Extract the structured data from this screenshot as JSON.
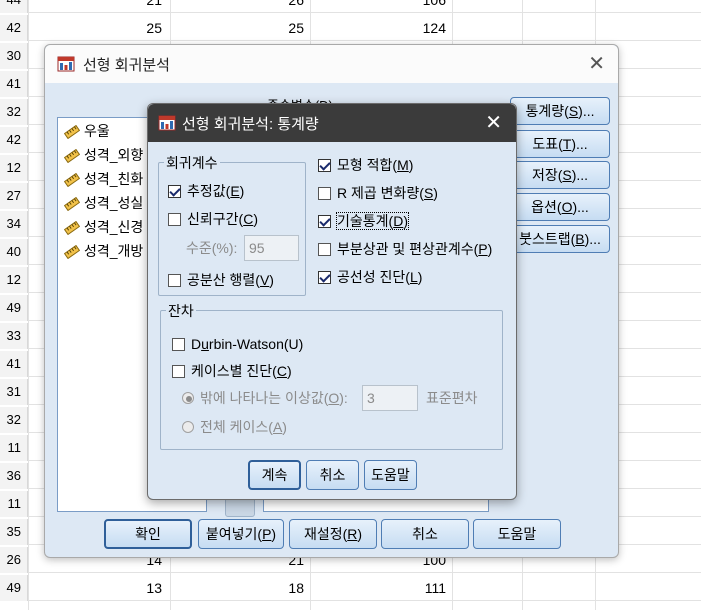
{
  "sheet": {
    "rows": [
      {
        "n": "44",
        "a": "21",
        "b": "26",
        "c": "106"
      },
      {
        "n": "42",
        "a": "25",
        "b": "25",
        "c": "124"
      },
      {
        "n": "30",
        "a": "",
        "b": "",
        "c": ""
      },
      {
        "n": "41",
        "a": "",
        "b": "",
        "c": ""
      },
      {
        "n": "32",
        "a": "",
        "b": "",
        "c": ""
      },
      {
        "n": "42",
        "a": "",
        "b": "",
        "c": ""
      },
      {
        "n": "12",
        "a": "",
        "b": "",
        "c": ""
      },
      {
        "n": "27",
        "a": "",
        "b": "",
        "c": ""
      },
      {
        "n": "34",
        "a": "",
        "b": "",
        "c": ""
      },
      {
        "n": "40",
        "a": "",
        "b": "",
        "c": ""
      },
      {
        "n": "12",
        "a": "",
        "b": "",
        "c": ""
      },
      {
        "n": "49",
        "a": "",
        "b": "",
        "c": ""
      },
      {
        "n": "33",
        "a": "",
        "b": "",
        "c": ""
      },
      {
        "n": "41",
        "a": "",
        "b": "",
        "c": ""
      },
      {
        "n": "31",
        "a": "",
        "b": "",
        "c": ""
      },
      {
        "n": "32",
        "a": "",
        "b": "",
        "c": ""
      },
      {
        "n": "11",
        "a": "",
        "b": "",
        "c": ""
      },
      {
        "n": "36",
        "a": "",
        "b": "",
        "c": ""
      },
      {
        "n": "11",
        "a": "",
        "b": "",
        "c": ""
      },
      {
        "n": "35",
        "a": "",
        "b": "",
        "c": ""
      },
      {
        "n": "26",
        "a": "14",
        "b": "21",
        "c": "100"
      },
      {
        "n": "49",
        "a": "13",
        "b": "18",
        "c": "111"
      }
    ]
  },
  "main_dialog": {
    "title": "선형 회귀분석",
    "dependent_label": "종속변수(D):",
    "variables": [
      "우울",
      "성격_외향",
      "성격_친화",
      "성격_성실",
      "성격_신경",
      "성격_개방"
    ],
    "side_buttons": {
      "statistics": {
        "pre": "통계량(",
        "key": "S",
        "post": ")..."
      },
      "plots": {
        "pre": "도표(",
        "key": "T",
        "post": ")..."
      },
      "save": {
        "pre": "저장(",
        "key": "S",
        "post": ")..."
      },
      "options": {
        "pre": "옵션(",
        "key": "O",
        "post": ")..."
      },
      "bootstrap": {
        "pre": "붓스트랩(",
        "key": "B",
        "post": ")..."
      }
    },
    "bottom_buttons": {
      "ok": "확인",
      "paste": {
        "pre": "붙여넣기(",
        "key": "P",
        "post": ")"
      },
      "reset": {
        "pre": "재설정(",
        "key": "R",
        "post": ")"
      },
      "cancel": "취소",
      "help": "도움말"
    }
  },
  "stats_dialog": {
    "title": "선형 회귀분석: 통계량",
    "coef_group": {
      "label": "회귀계수",
      "estimates": {
        "pre": "추정값(",
        "key": "E",
        "post": ")",
        "checked": true
      },
      "conf_int": {
        "pre": "신뢰구간(",
        "key": "C",
        "post": ")",
        "checked": false
      },
      "level_label": {
        "pre": "수준(%):",
        "key": "",
        "post": ""
      },
      "level_value": "95",
      "cov_matrix": {
        "pre": "공분산 행렬(",
        "key": "V",
        "post": ")",
        "checked": false
      }
    },
    "right_checks": {
      "model_fit": {
        "pre": "모형 적합(",
        "key": "M",
        "post": ")",
        "checked": true
      },
      "r_change": {
        "pre": "R 제곱 변화량(",
        "key": "S",
        "post": ")",
        "checked": false
      },
      "descriptives": {
        "pre": "기술통계(",
        "key": "D",
        "post": ")",
        "checked": true
      },
      "part_partial": {
        "pre": "부분상관 및 편상관계수(",
        "key": "P",
        "post": ")",
        "checked": false
      },
      "collinearity": {
        "pre": "공선성 진단(",
        "key": "L",
        "post": ")",
        "checked": true
      }
    },
    "residuals_group": {
      "label": "잔차",
      "durbin_watson": {
        "pre": "D",
        "key": "u",
        "post": "rbin-Watson(U)",
        "checked": false
      },
      "casewise": {
        "pre": "케이스별 진단(",
        "key": "C",
        "post": ")",
        "checked": false
      },
      "outliers": {
        "pre": "밖에 나타나는 이상값(",
        "key": "O",
        "post": "):",
        "selected": true
      },
      "outlier_value": "3",
      "std_dev_label": "표준편차",
      "all_cases": {
        "pre": "전체 케이스(",
        "key": "A",
        "post": ")",
        "selected": false
      }
    },
    "buttons": {
      "continue": "계속",
      "cancel": "취소",
      "help": "도움말"
    }
  }
}
